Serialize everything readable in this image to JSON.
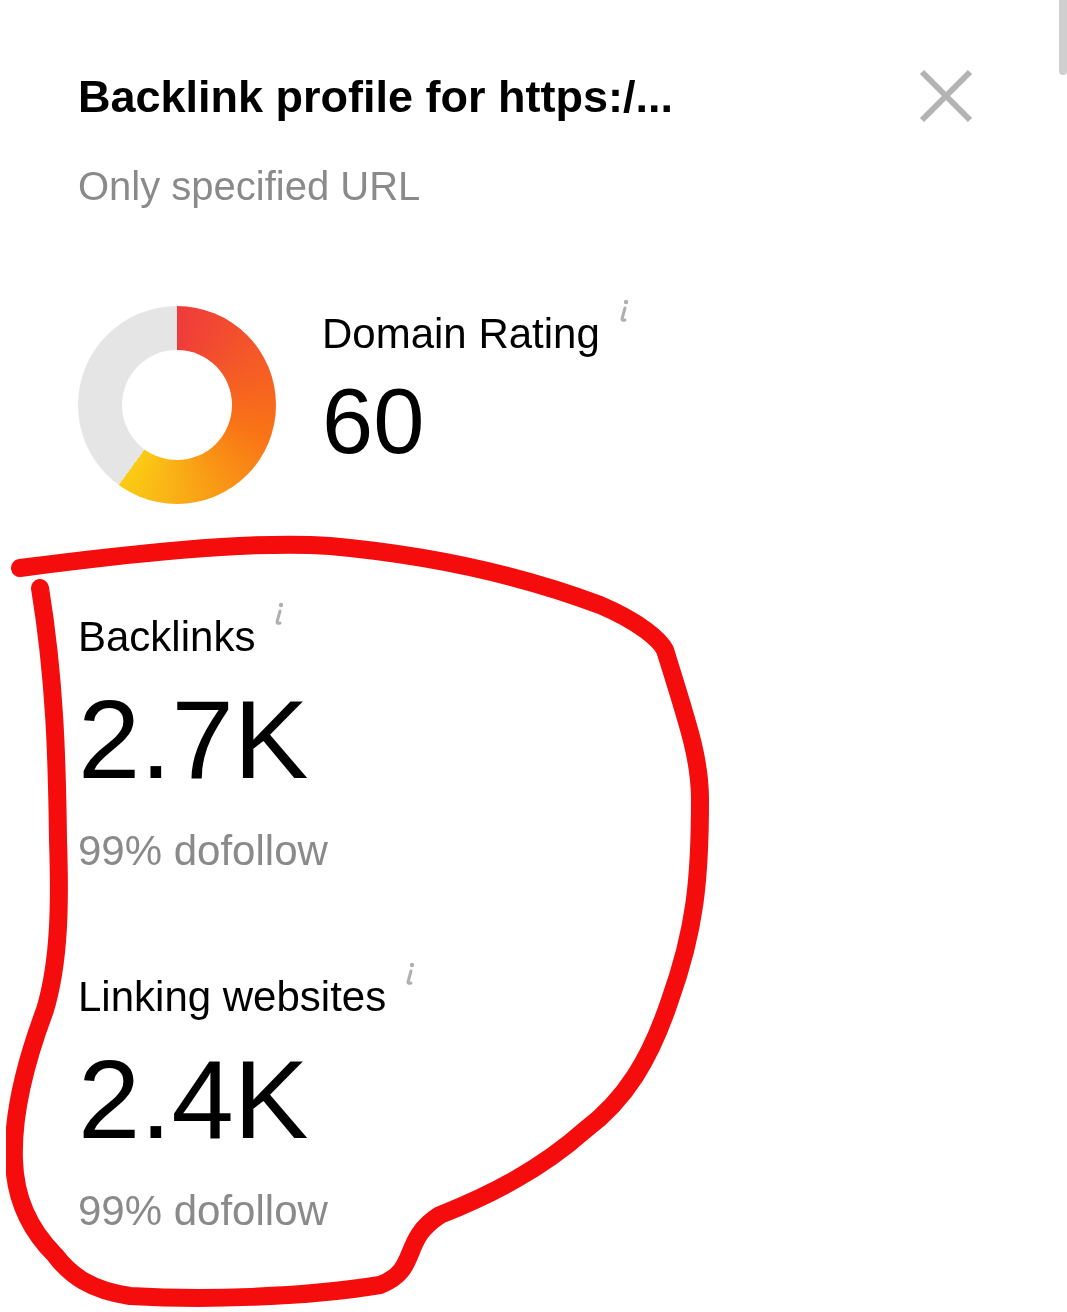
{
  "panel": {
    "title": "Backlink profile for https:/...",
    "subtitle": "Only specified URL"
  },
  "domain_rating": {
    "label": "Domain Rating",
    "value": "60"
  },
  "metrics": [
    {
      "label": "Backlinks",
      "value": "2.7K",
      "note": "99% dofollow"
    },
    {
      "label": "Linking websites",
      "value": "2.4K",
      "note": "99% dofollow"
    }
  ]
}
